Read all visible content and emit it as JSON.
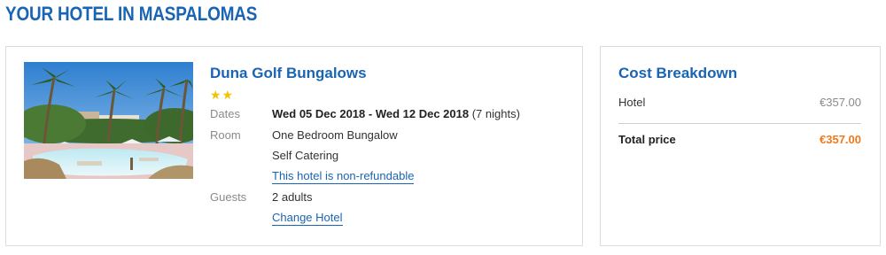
{
  "page": {
    "heading": "YOUR HOTEL IN MASPALOMAS"
  },
  "hotel": {
    "name": "Duna Golf Bungalows",
    "stars": 2,
    "stars_glyphs": "★★",
    "photo_icon": "hotel-pool-photo",
    "dates_label": "Dates",
    "dates_value": "Wed 05 Dec 2018 - Wed 12 Dec 2018",
    "nights": "(7 nights)",
    "room_label": "Room",
    "room_type": "One Bedroom Bungalow",
    "board": "Self Catering",
    "refund_link": "This hotel is non-refundable",
    "guests_label": "Guests",
    "guests_value": "2 adults",
    "change_link": "Change Hotel"
  },
  "cost": {
    "title": "Cost Breakdown",
    "hotel_label": "Hotel",
    "hotel_amount": "€357.00",
    "total_label": "Total price",
    "total_amount": "€357.00"
  },
  "colors": {
    "accent": "#1a64b4",
    "total": "#f07a1a",
    "stars": "#f2c400",
    "muted": "#8a8a8a"
  }
}
